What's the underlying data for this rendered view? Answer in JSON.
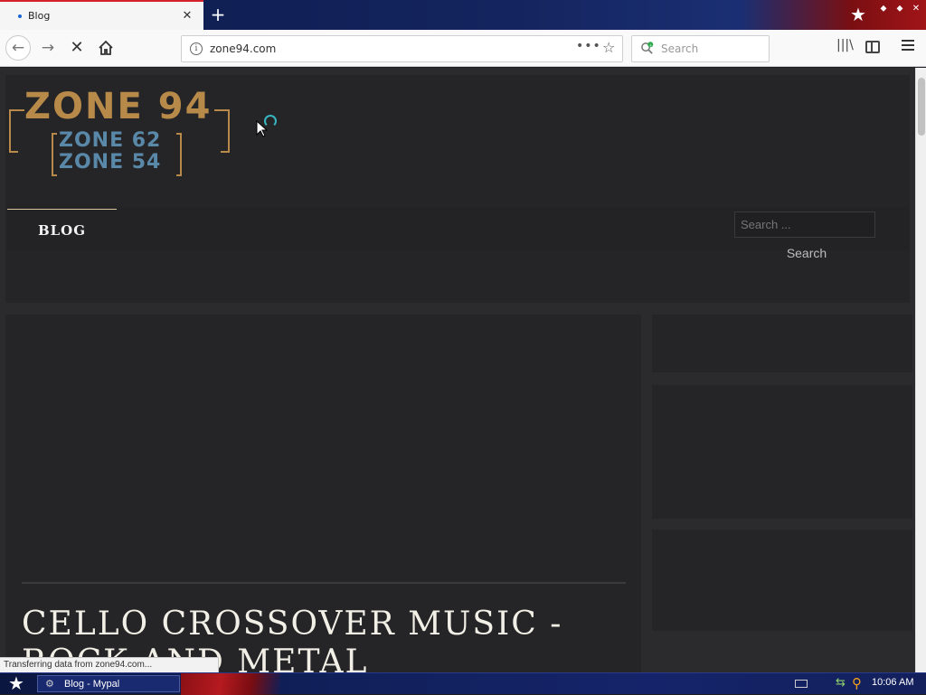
{
  "browser": {
    "tab": {
      "title": "Blog"
    },
    "url": "zone94.com",
    "search_placeholder": "Search",
    "status_text": "Transferring data from zone94.com..."
  },
  "page": {
    "logo": {
      "line1": "ZONE 94",
      "line2": "ZONE 62",
      "line3": "ZONE 54"
    },
    "nav": {
      "blog": "BLOG"
    },
    "site_search": {
      "placeholder": "Search ...",
      "button": "Search"
    },
    "article": {
      "title": "CELLO CROSSOVER MUSIC - ROCK AND METAL"
    }
  },
  "taskbar": {
    "window_label": "Blog - Mypal",
    "clock": "10:06 AM"
  },
  "icons": {
    "tab_close": "close-icon",
    "new_tab": "plus-icon",
    "back": "back-arrow-icon",
    "forward": "forward-arrow-icon",
    "stop": "stop-icon",
    "home": "home-icon",
    "info": "info-icon",
    "more": "more-actions-icon",
    "bookmark": "star-icon",
    "library": "library-icon",
    "sidebar": "sidebar-icon",
    "menu": "hamburger-menu-icon"
  },
  "colors": {
    "page_bg": "#2b2b2d",
    "block_bg": "#252527",
    "logo_gold": "#b88a4a",
    "logo_blue": "#5a88a8",
    "tab_accent": "#d6202a",
    "taskbar_blue": "#15246a"
  }
}
